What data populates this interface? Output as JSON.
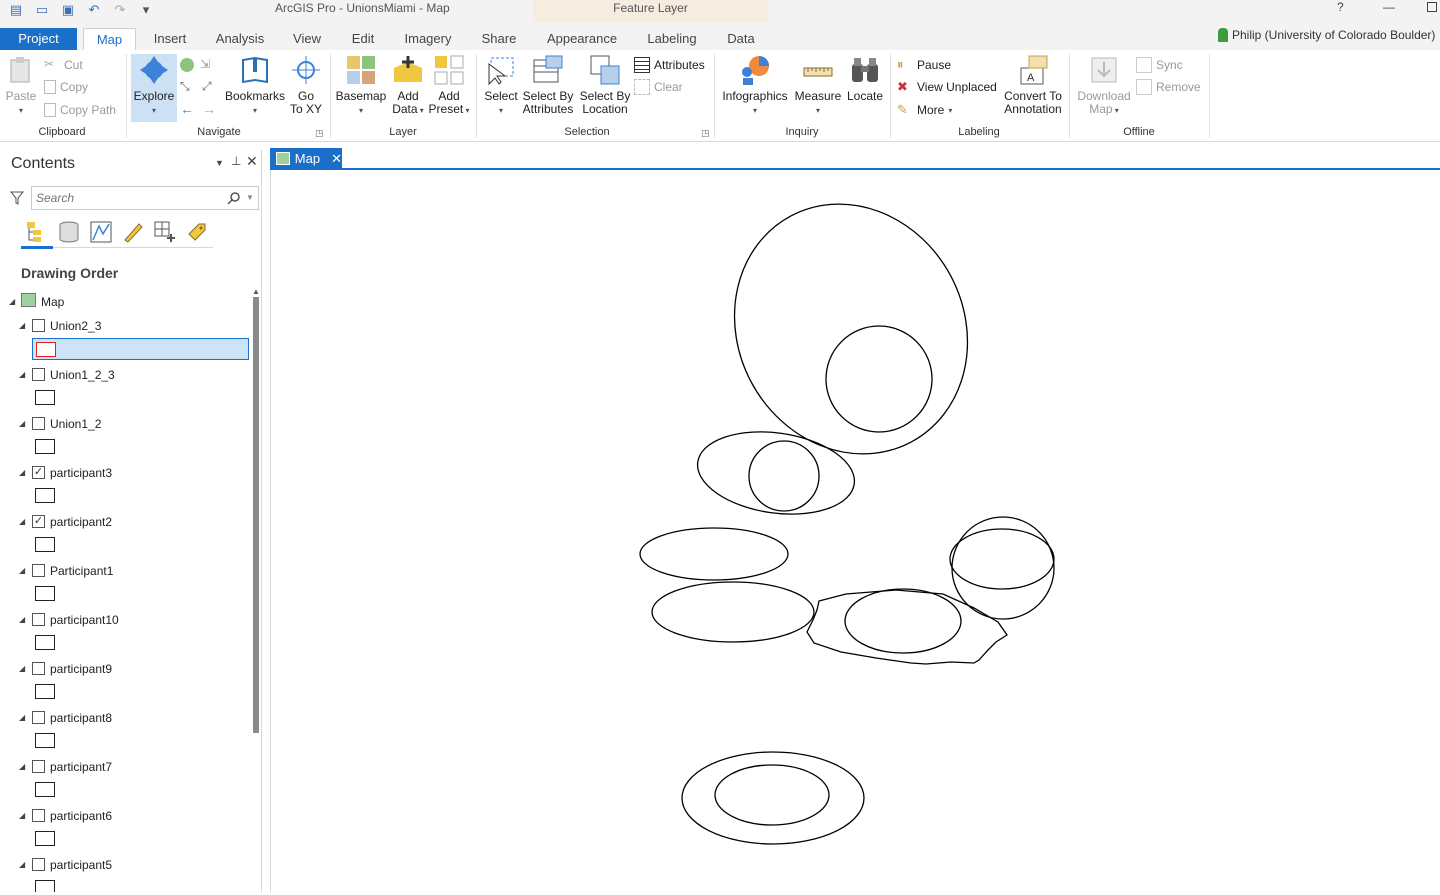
{
  "titlebar": {
    "app_title": "ArcGIS Pro - UnionsMiami - Map",
    "contextual_title": "Feature Layer",
    "help": "?",
    "minimize": "—"
  },
  "tabs": {
    "project": "Project",
    "items": [
      {
        "label": "Map",
        "active": true
      },
      {
        "label": "Insert"
      },
      {
        "label": "Analysis"
      },
      {
        "label": "View"
      },
      {
        "label": "Edit"
      },
      {
        "label": "Imagery"
      },
      {
        "label": "Share"
      },
      {
        "label": "Appearance"
      },
      {
        "label": "Labeling"
      },
      {
        "label": "Data"
      }
    ],
    "user": "Philip (University of Colorado Boulder)"
  },
  "ribbon": {
    "clipboard": {
      "label": "Clipboard",
      "paste": "Paste",
      "cut": "Cut",
      "copy": "Copy",
      "copy_path": "Copy Path"
    },
    "navigate": {
      "label": "Navigate",
      "explore": "Explore",
      "bookmarks": "Bookmarks",
      "go_to_xy_1": "Go",
      "go_to_xy_2": "To XY"
    },
    "layer": {
      "label": "Layer",
      "basemap": "Basemap",
      "add_data_1": "Add",
      "add_data_2": "Data",
      "add_preset_1": "Add",
      "add_preset_2": "Preset"
    },
    "selection": {
      "label": "Selection",
      "select": "Select",
      "sba_1": "Select By",
      "sba_2": "Attributes",
      "sbl_1": "Select By",
      "sbl_2": "Location",
      "attributes": "Attributes",
      "clear": "Clear"
    },
    "inquiry": {
      "label": "Inquiry",
      "infographics": "Infographics",
      "measure": "Measure",
      "locate": "Locate"
    },
    "labeling": {
      "label": "Labeling",
      "pause": "Pause",
      "view_unplaced": "View Unplaced",
      "more": "More",
      "convert_1": "Convert To",
      "convert_2": "Annotation"
    },
    "offline": {
      "label": "Offline",
      "download_1": "Download",
      "download_2": "Map",
      "sync": "Sync",
      "remove": "Remove"
    }
  },
  "contents": {
    "title": "Contents",
    "search_placeholder": "Search",
    "drawing_order": "Drawing Order",
    "map_label": "Map",
    "layers": [
      {
        "name": "Union2_3",
        "checked": false,
        "selected": true
      },
      {
        "name": "Union1_2_3",
        "checked": false
      },
      {
        "name": "Union1_2",
        "checked": false
      },
      {
        "name": "participant3",
        "checked": true
      },
      {
        "name": "participant2",
        "checked": true
      },
      {
        "name": "Participant1",
        "checked": false
      },
      {
        "name": "participant10",
        "checked": false
      },
      {
        "name": "participant9",
        "checked": false
      },
      {
        "name": "participant8",
        "checked": false
      },
      {
        "name": "participant7",
        "checked": false
      },
      {
        "name": "participant6",
        "checked": false
      },
      {
        "name": "participant5",
        "checked": false
      }
    ]
  },
  "map_view": {
    "tab_label": "Map",
    "close": "✕"
  },
  "colors": {
    "accent": "#1a6fc9",
    "selection_fill": "#cfe3f7",
    "contextual": "#f7ece0"
  }
}
